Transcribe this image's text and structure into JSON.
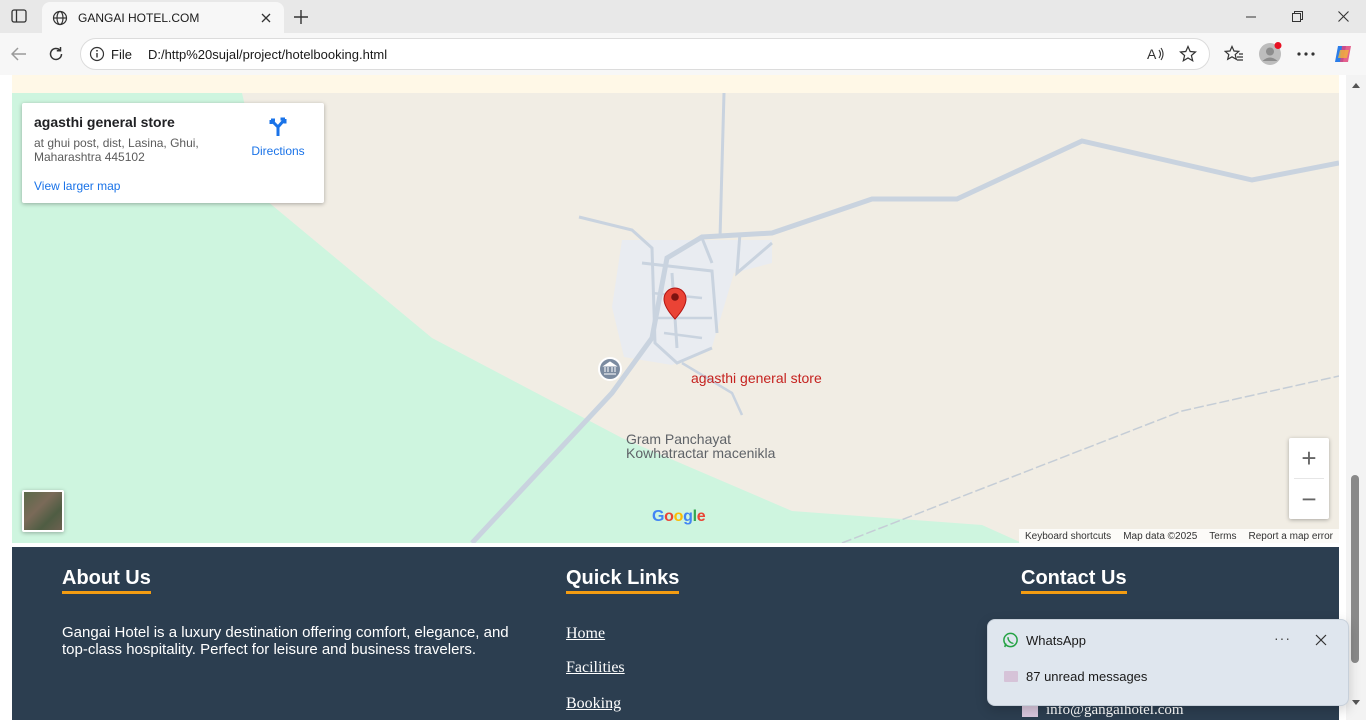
{
  "browser": {
    "tab_title": "GANGAI HOTEL.COM",
    "address_scheme": "File",
    "url": "D:/http%20sujal/project/hotelbooking.html"
  },
  "map": {
    "place_name": "agasthi general store",
    "place_address": "at ghui post, dist, Lasina, Ghui, Maharashtra 445102",
    "directions_label": "Directions",
    "larger_map_link": "View larger map",
    "marker_label": "agasthi general store",
    "poi_label_line1": "Gram Panchayat",
    "poi_label_line2": "Kowhatractar macenikla",
    "zoom_in": "+",
    "zoom_out": "−",
    "attribution": {
      "shortcuts": "Keyboard shortcuts",
      "map_data": "Map data ©2025",
      "terms": "Terms",
      "report": "Report a map error"
    },
    "colors": {
      "land": "#f1ede4",
      "park": "#cef5df",
      "road": "#c9d3df",
      "marker": "#ea4335"
    }
  },
  "footer": {
    "about_title": "About Us",
    "about_text": "Gangai Hotel is a luxury destination offering comfort, elegance, and top-class hospitality. Perfect for leisure and business travelers.",
    "quick_links_title": "Quick Links",
    "quick_links": [
      "Home",
      "Facilities",
      "Booking"
    ],
    "contact_title": "Contact Us",
    "contact_email": "info@gangaihotel.com",
    "colors": {
      "background": "#2c3e50",
      "accent": "#f39c12"
    }
  },
  "notification": {
    "app_name": "WhatsApp",
    "message": "87 unread messages"
  }
}
